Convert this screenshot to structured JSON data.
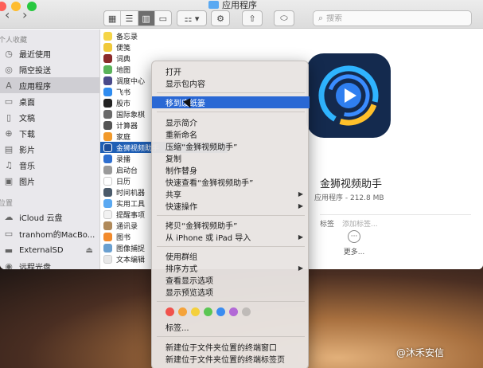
{
  "window": {
    "title": "应用程序"
  },
  "toolbar": {
    "search_placeholder": "搜索",
    "view_modes": [
      "icon-view",
      "list-view",
      "column-view",
      "gallery-view"
    ],
    "active_view": "column-view"
  },
  "sidebar": {
    "favorites_heading": "个人收藏",
    "devices_heading": "位置",
    "items": [
      {
        "label": "最近使用",
        "icon": "clock-icon"
      },
      {
        "label": "隔空投送",
        "icon": "airdrop-icon"
      },
      {
        "label": "应用程序",
        "icon": "apps-icon",
        "selected": true
      },
      {
        "label": "桌面",
        "icon": "desktop-icon"
      },
      {
        "label": "文稿",
        "icon": "document-icon"
      },
      {
        "label": "下载",
        "icon": "download-icon"
      },
      {
        "label": "影片",
        "icon": "film-icon"
      },
      {
        "label": "音乐",
        "icon": "music-icon"
      },
      {
        "label": "图片",
        "icon": "picture-icon"
      }
    ],
    "locations": [
      {
        "label": "iCloud 云盘",
        "icon": "cloud-icon"
      },
      {
        "label": "tranhom的MacBo...",
        "icon": "laptop-icon"
      },
      {
        "label": "ExternalSD",
        "icon": "drive-icon"
      },
      {
        "label": "远程光盘",
        "icon": "disc-icon"
      }
    ]
  },
  "files": [
    {
      "label": "备忘录",
      "color": "#f5d547"
    },
    {
      "label": "便笺",
      "color": "#f0c93a"
    },
    {
      "label": "词典",
      "color": "#8b2a2a"
    },
    {
      "label": "地图",
      "color": "#5ab35a"
    },
    {
      "label": "调度中心",
      "color": "#4a4a8a"
    },
    {
      "label": "飞书",
      "color": "#2f8cf0"
    },
    {
      "label": "股市",
      "color": "#222222"
    },
    {
      "label": "国际象棋",
      "color": "#6a6a6a"
    },
    {
      "label": "计算器",
      "color": "#555555"
    },
    {
      "label": "家庭",
      "color": "#f29a2b"
    },
    {
      "label": "金狮视频助手",
      "color": "#1d4e9a",
      "selected": true
    },
    {
      "label": "录播",
      "color": "#2e6fd0"
    },
    {
      "label": "启动台",
      "color": "#9a9a9a"
    },
    {
      "label": "日历",
      "color": "#ffffff"
    },
    {
      "label": "时间机器",
      "color": "#4a5a6a"
    },
    {
      "label": "实用工具",
      "color": "#5aa9f2"
    },
    {
      "label": "提醒事项",
      "color": "#f2f2f2"
    },
    {
      "label": "通讯录",
      "color": "#b08a5a"
    },
    {
      "label": "图书",
      "color": "#f28a2b"
    },
    {
      "label": "图像捕捉",
      "color": "#6aa0d0"
    },
    {
      "label": "文本编辑",
      "color": "#e8e8e8"
    }
  ],
  "preview": {
    "app_name": "金狮视频助手",
    "meta": "应用程序 - 212.8 MB",
    "tags_label": "标签",
    "tags_placeholder": "添加标签...",
    "more_label": "更多..."
  },
  "context_menu": {
    "groups": [
      [
        "打开",
        "显示包内容"
      ],
      [
        "移到废纸篓"
      ],
      [
        "显示简介",
        "重新命名",
        "压缩“金狮视频助手”",
        "复制",
        "制作替身",
        "快速查看“金狮视频助手”",
        "共享",
        "快速操作"
      ],
      [
        "拷贝“金狮视频助手”",
        "从 iPhone 或 iPad 导入"
      ],
      [
        "使用群组",
        "排序方式",
        "查看显示选项",
        "显示预览选项"
      ],
      [
        "标签..."
      ],
      [
        "新建位于文件夹位置的终端窗口",
        "新建位于文件夹位置的终端标签页"
      ]
    ],
    "highlighted": "移到废纸篓",
    "submenu_items": [
      "共享",
      "快速操作",
      "从 iPhone 或 iPad 导入",
      "排序方式"
    ],
    "tag_colors": [
      "#f0524c",
      "#f5a33a",
      "#f4d03c",
      "#5bc653",
      "#3a8cf0",
      "#b269d6",
      "#bfbbb8"
    ]
  },
  "watermark": "@沐禾安信"
}
